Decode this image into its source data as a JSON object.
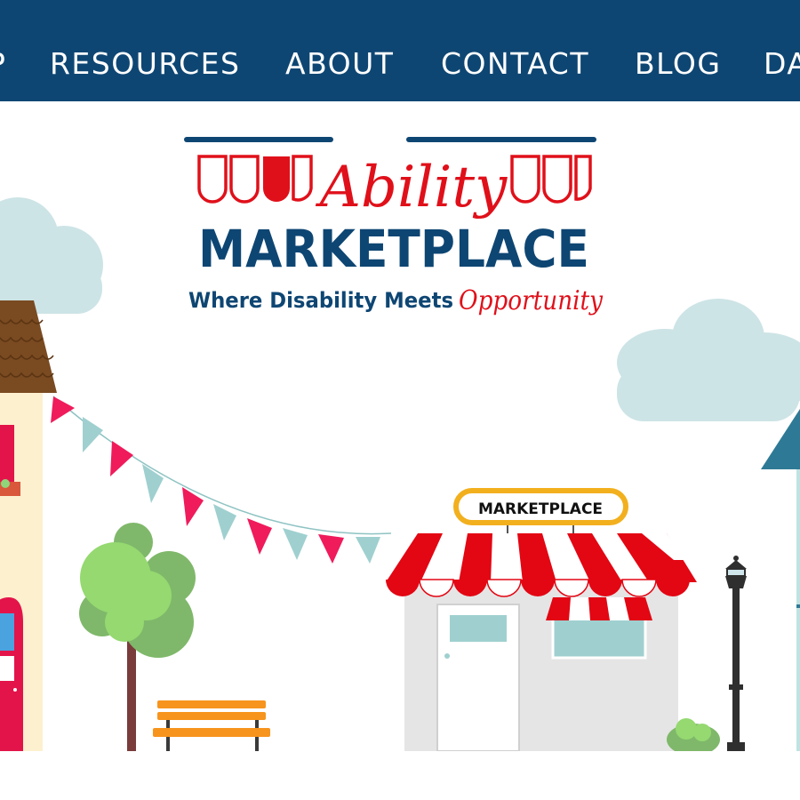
{
  "nav": {
    "items": [
      {
        "label": "P"
      },
      {
        "label": "RESOURCES"
      },
      {
        "label": "ABOUT"
      },
      {
        "label": "CONTACT"
      },
      {
        "label": "BLOG"
      },
      {
        "label": "DA"
      }
    ]
  },
  "logo": {
    "script_word": "Ability",
    "main_word": "MARKETPLACE",
    "tagline": "Where Disability Meets",
    "tagline_script": "Opportunity"
  },
  "scene": {
    "shop_sign": "MARKETPLACE"
  },
  "colors": {
    "nav_bg": "#0e4673",
    "logo_red": "#e0101a",
    "logo_blue": "#0e4673",
    "cloud": "#cde4e6",
    "awning_red": "#e30613",
    "bench_orange": "#f7941d",
    "sign_yellow": "#f2b01e",
    "tree_green": "#8fd67a"
  }
}
